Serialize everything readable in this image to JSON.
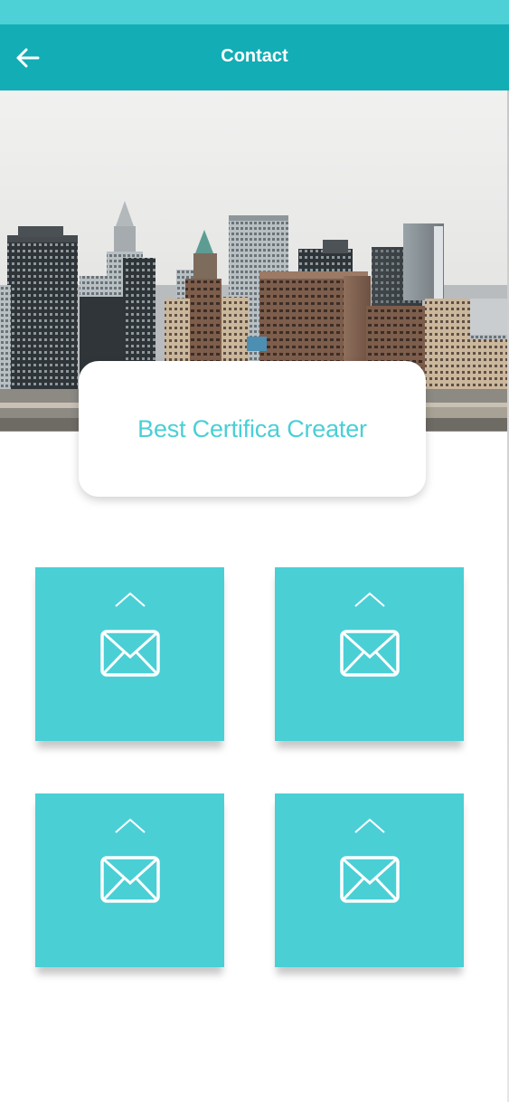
{
  "theme": {
    "status_bar_color": "#4dd0d6",
    "app_bar_color": "#13adb5",
    "accent_color": "#4acfd5",
    "title_text_color": "#4acfd5"
  },
  "app_bar": {
    "title": "Contact",
    "back_icon": "arrow-left-icon"
  },
  "hero": {
    "image": "city-skyline-photo"
  },
  "card": {
    "title": "Best Certifica Creater"
  },
  "tiles": [
    {
      "icon": "mail-icon",
      "indicator": "chevron-up-icon"
    },
    {
      "icon": "mail-icon",
      "indicator": "chevron-up-icon"
    },
    {
      "icon": "mail-icon",
      "indicator": "chevron-up-icon"
    },
    {
      "icon": "mail-icon",
      "indicator": "chevron-up-icon"
    }
  ]
}
